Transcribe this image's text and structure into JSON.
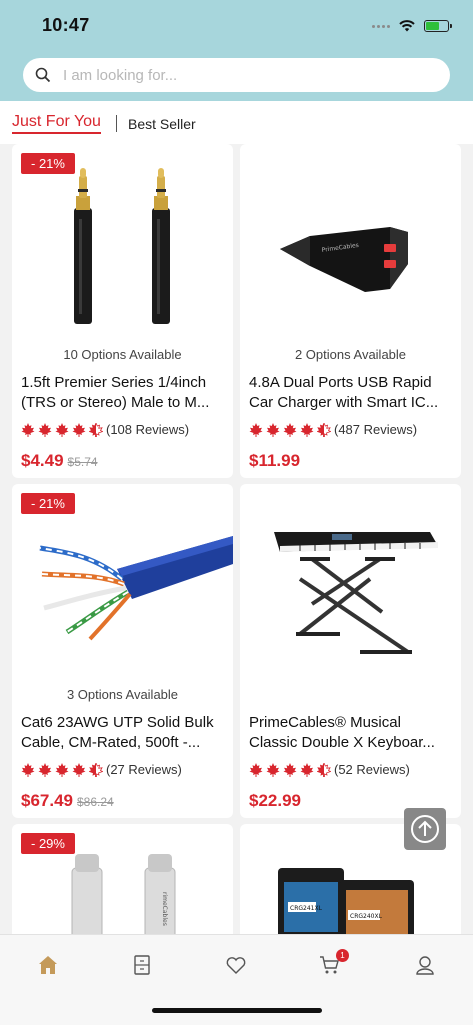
{
  "status_bar": {
    "time": "10:47"
  },
  "search": {
    "placeholder": "I am looking for..."
  },
  "tabs": {
    "active": "Just For You",
    "inactive": "Best Seller"
  },
  "products": [
    {
      "badge": "- 21%",
      "options": "10 Options Available",
      "name_line1": "1.5ft Premier Series 1/4inch",
      "name_line2": "(TRS or Stereo) Male to M...",
      "rating": 4.5,
      "reviews": "(108 Reviews)",
      "price": "$4.49",
      "old_price": "$5.74"
    },
    {
      "badge": "",
      "options": "2 Options Available",
      "name_line1": "4.8A Dual Ports USB Rapid",
      "name_line2": "Car Charger with Smart IC...",
      "rating": 4.5,
      "reviews": "(487 Reviews)",
      "price": "$11.99",
      "old_price": ""
    },
    {
      "badge": "- 21%",
      "options": "3 Options Available",
      "name_line1": "Cat6 23AWG UTP Solid Bulk",
      "name_line2": "Cable, CM-Rated, 500ft -...",
      "rating": 4.5,
      "reviews": "(27 Reviews)",
      "price": "$67.49",
      "old_price": "$86.24"
    },
    {
      "badge": "",
      "options": "",
      "name_line1": "PrimeCables® Musical",
      "name_line2": "Classic Double X Keyboar...",
      "rating": 4.5,
      "reviews": "(52 Reviews)",
      "price": "$22.99",
      "old_price": ""
    },
    {
      "badge": "- 29%"
    }
  ],
  "image_labels": {
    "charger": "PrimeCables",
    "usbc": "rimeCables",
    "cartridge1": "CRG241XL",
    "cartridge2": "CRG240XL"
  },
  "bottom_nav": {
    "items": [
      "home-icon",
      "catalog-icon",
      "heart-icon",
      "cart-icon",
      "account-icon"
    ],
    "cart_count": "1"
  },
  "colors": {
    "accent": "#d8262e",
    "header": "#a7d6dc"
  }
}
